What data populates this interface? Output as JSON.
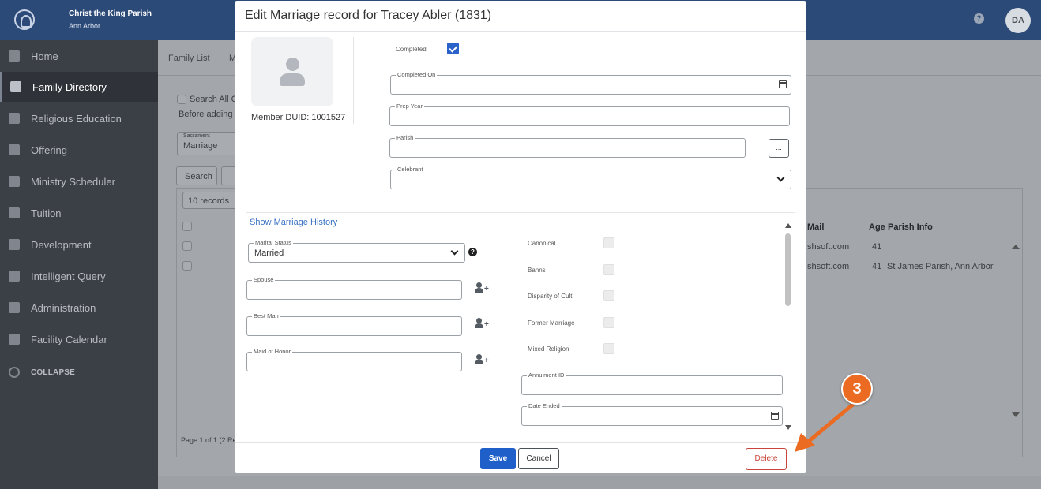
{
  "header": {
    "parish_name": "Christ the King Parish",
    "parish_city": "Ann Arbor",
    "help_symbol": "?",
    "user_initials": "DA"
  },
  "sidebar": {
    "items": [
      {
        "label": "Home",
        "icon": "home-icon"
      },
      {
        "label": "Family Directory",
        "icon": "users-icon",
        "active": true
      },
      {
        "label": "Religious Education",
        "icon": "school-icon"
      },
      {
        "label": "Offering",
        "icon": "heart-icon"
      },
      {
        "label": "Ministry Scheduler",
        "icon": "calendar-icon"
      },
      {
        "label": "Tuition",
        "icon": "money-icon"
      },
      {
        "label": "Development",
        "icon": "sitemap-icon"
      },
      {
        "label": "Intelligent Query",
        "icon": "file-icon"
      },
      {
        "label": "Administration",
        "icon": "gear-icon"
      },
      {
        "label": "Facility Calendar",
        "icon": "building-icon"
      }
    ],
    "collapse_label": "COLLAPSE"
  },
  "background": {
    "tab_family_list": "Family List",
    "tab_partial": "M",
    "search_all": "Search All C",
    "before_adding": "Before adding",
    "sacrament_label": "Sacrament",
    "sacrament_value": "Marriage",
    "search_button": "Search",
    "records_select": "10 records",
    "col_mail": "Mail",
    "col_age": "Age",
    "col_parish_info": "Parish Info",
    "row1_email": "shsoft.com",
    "row1_age": "41",
    "row2_email": "shsoft.com",
    "row2_age": "41",
    "row2_parish": "St James Parish, Ann Arbor",
    "paging": "Page 1 of 1 (2 Re"
  },
  "modal": {
    "title": "Edit Marriage record for Tracey Abler (1831)",
    "member_duid": "Member DUID: 1001527",
    "completed_label": "Completed",
    "completed_checked": true,
    "completed_on_label": "Completed On",
    "completed_on_value": "",
    "prep_year_label": "Prep Year",
    "prep_year_value": "",
    "parish_label": "Parish",
    "parish_value": "",
    "parish_button": "...",
    "celebrant_label": "Celebrant",
    "celebrant_value": "",
    "history_link": "Show Marriage History",
    "marital_status_label": "Marital Status",
    "marital_status_value": "Married",
    "marital_help": "?",
    "spouse_label": "Spouse",
    "best_man_label": "Best Man",
    "maid_of_honor_label": "Maid of Honor",
    "canonical_label": "Canonical",
    "banns_label": "Banns",
    "disparity_label": "Disparity of Cult",
    "former_marriage_label": "Former Marriage",
    "mixed_religion_label": "Mixed Religion",
    "annulment_label": "Annulment ID",
    "date_ended_label": "Date Ended",
    "save_label": "Save",
    "cancel_label": "Cancel",
    "delete_label": "Delete"
  },
  "annotation": {
    "step_number": "3",
    "accent_color": "#ec6b22"
  }
}
